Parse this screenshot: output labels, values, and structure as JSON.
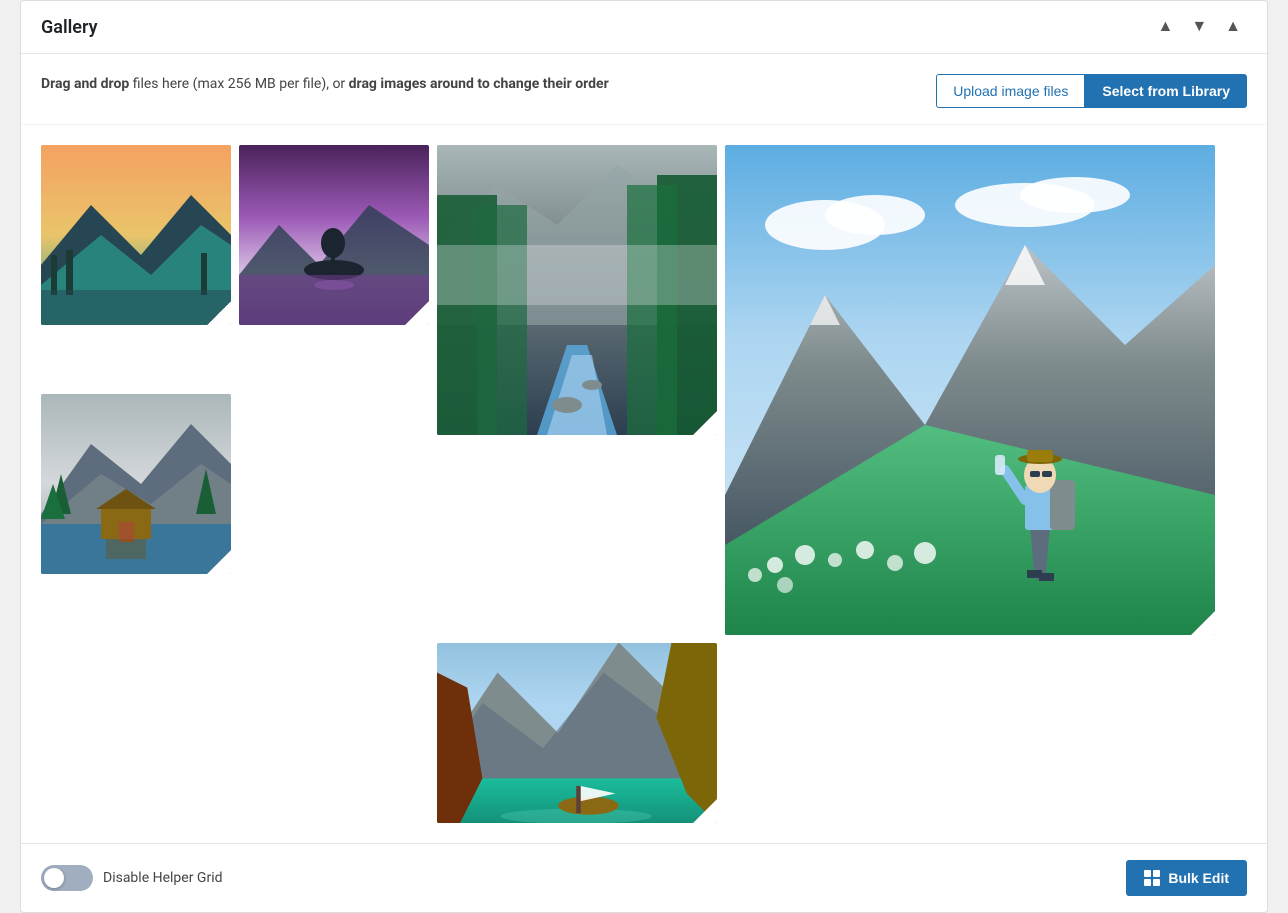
{
  "panel": {
    "title": "Gallery",
    "header_controls": {
      "up_label": "▲",
      "down_label": "▼",
      "collapse_label": "▲"
    }
  },
  "toolbar": {
    "description_prefix": "Drag and drop",
    "description_middle": " files here (max 256 MB per file), or ",
    "description_bold": "drag images around to change their order",
    "upload_button_label": "Upload image files",
    "library_button_label": "Select from Library"
  },
  "gallery": {
    "images": [
      {
        "id": 1,
        "alt": "Yosemite landscape",
        "class": "thumb-1 img-yosemite"
      },
      {
        "id": 2,
        "alt": "Purple lake at dusk",
        "class": "thumb-2 img-purple-lake"
      },
      {
        "id": 3,
        "alt": "Forest river with mist",
        "class": "thumb-3 img-forest-river"
      },
      {
        "id": 4,
        "alt": "Mountain hiker drinking water",
        "class": "thumb-4 img-mountain-hiker"
      },
      {
        "id": 5,
        "alt": "Cabin by mountain lake",
        "class": "thumb-5 img-cabin-lake"
      },
      {
        "id": 6,
        "alt": "Turquoise lake with boat",
        "class": "thumb-6 img-turquoise-lake"
      }
    ]
  },
  "footer": {
    "toggle_label": "Disable Helper Grid",
    "bulk_edit_label": "Bulk Edit"
  }
}
